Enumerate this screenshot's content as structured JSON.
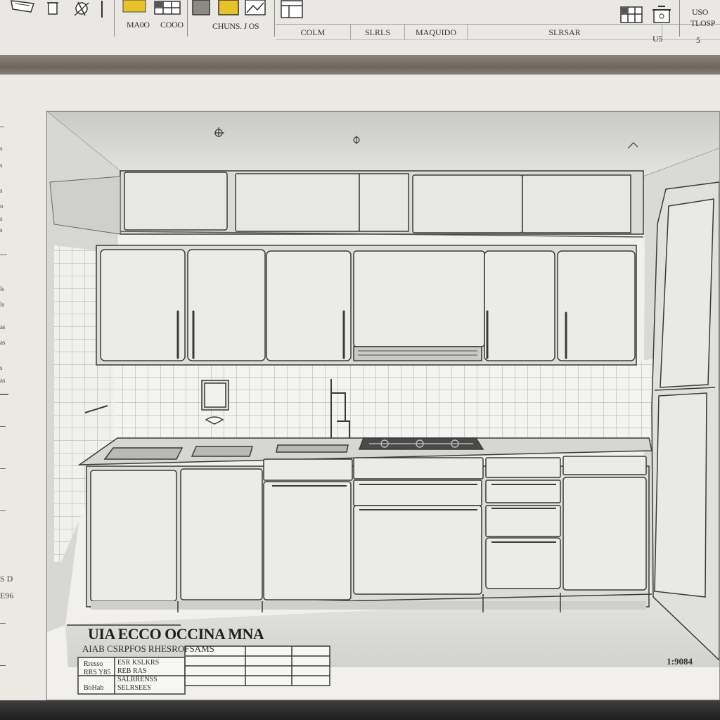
{
  "toolbar": {
    "label_1": "MA0O",
    "label_2": "COOO",
    "label_3": "CHUNS. J OS",
    "tabs": [
      "COLM",
      "SLRLS",
      "MAQUIDO",
      "SLRSAR"
    ],
    "right_top": "USO",
    "right_mid": "TLOSP",
    "right_bottom_1": "U5",
    "right_bottom_2": "5"
  },
  "ruler": {
    "labels": [
      "s",
      "s",
      "s",
      "o",
      "s",
      "s",
      "ls",
      "ls",
      "as",
      "as",
      "s",
      "as",
      "S D",
      "E96"
    ]
  },
  "drawing": {
    "title": "UIA ECCO OCCINA MNA",
    "subtitle": "AIAB CSRPFOS RHESROFSAMS",
    "block_cells": [
      "Rresso",
      "RRS Y85",
      "BoHab",
      "ESR KSLKRS",
      "REB RAS",
      "SALRRENSS",
      "SELRSEES"
    ],
    "scale": "1:9084"
  },
  "colors": {
    "accent_yellow": "#e8c22a",
    "paper": "#f1f0ec",
    "line": "#3a3a3a"
  }
}
